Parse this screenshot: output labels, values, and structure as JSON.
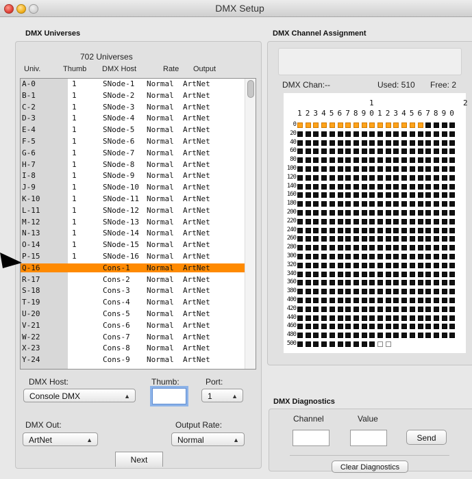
{
  "window": {
    "title": "DMX Setup"
  },
  "universes": {
    "section_title": "DMX Universes",
    "count_label": "702 Universes",
    "columns": [
      "Univ.",
      "Thumb",
      "DMX Host",
      "Rate",
      "Output"
    ],
    "rows": [
      {
        "univ": "A-0",
        "thumb": "1",
        "host": "SNode-1",
        "rate": "Normal",
        "output": "ArtNet"
      },
      {
        "univ": "B-1",
        "thumb": "1",
        "host": "SNode-2",
        "rate": "Normal",
        "output": "ArtNet"
      },
      {
        "univ": "C-2",
        "thumb": "1",
        "host": "SNode-3",
        "rate": "Normal",
        "output": "ArtNet"
      },
      {
        "univ": "D-3",
        "thumb": "1",
        "host": "SNode-4",
        "rate": "Normal",
        "output": "ArtNet"
      },
      {
        "univ": "E-4",
        "thumb": "1",
        "host": "SNode-5",
        "rate": "Normal",
        "output": "ArtNet"
      },
      {
        "univ": "F-5",
        "thumb": "1",
        "host": "SNode-6",
        "rate": "Normal",
        "output": "ArtNet"
      },
      {
        "univ": "G-6",
        "thumb": "1",
        "host": "SNode-7",
        "rate": "Normal",
        "output": "ArtNet"
      },
      {
        "univ": "H-7",
        "thumb": "1",
        "host": "SNode-8",
        "rate": "Normal",
        "output": "ArtNet"
      },
      {
        "univ": "I-8",
        "thumb": "1",
        "host": "SNode-9",
        "rate": "Normal",
        "output": "ArtNet"
      },
      {
        "univ": "J-9",
        "thumb": "1",
        "host": "SNode-10",
        "rate": "Normal",
        "output": "ArtNet"
      },
      {
        "univ": "K-10",
        "thumb": "1",
        "host": "SNode-11",
        "rate": "Normal",
        "output": "ArtNet"
      },
      {
        "univ": "L-11",
        "thumb": "1",
        "host": "SNode-12",
        "rate": "Normal",
        "output": "ArtNet"
      },
      {
        "univ": "M-12",
        "thumb": "1",
        "host": "SNode-13",
        "rate": "Normal",
        "output": "ArtNet"
      },
      {
        "univ": "N-13",
        "thumb": "1",
        "host": "SNode-14",
        "rate": "Normal",
        "output": "ArtNet"
      },
      {
        "univ": "O-14",
        "thumb": "1",
        "host": "SNode-15",
        "rate": "Normal",
        "output": "ArtNet"
      },
      {
        "univ": "P-15",
        "thumb": "1",
        "host": "SNode-16",
        "rate": "Normal",
        "output": "ArtNet"
      },
      {
        "univ": "Q-16",
        "thumb": "",
        "host": "Cons-1",
        "rate": "Normal",
        "output": "ArtNet",
        "selected": true
      },
      {
        "univ": "R-17",
        "thumb": "",
        "host": "Cons-2",
        "rate": "Normal",
        "output": "ArtNet"
      },
      {
        "univ": "S-18",
        "thumb": "",
        "host": "Cons-3",
        "rate": "Normal",
        "output": "ArtNet"
      },
      {
        "univ": "T-19",
        "thumb": "",
        "host": "Cons-4",
        "rate": "Normal",
        "output": "ArtNet"
      },
      {
        "univ": "U-20",
        "thumb": "",
        "host": "Cons-5",
        "rate": "Normal",
        "output": "ArtNet"
      },
      {
        "univ": "V-21",
        "thumb": "",
        "host": "Cons-6",
        "rate": "Normal",
        "output": "ArtNet"
      },
      {
        "univ": "W-22",
        "thumb": "",
        "host": "Cons-7",
        "rate": "Normal",
        "output": "ArtNet"
      },
      {
        "univ": "X-23",
        "thumb": "",
        "host": "Cons-8",
        "rate": "Normal",
        "output": "ArtNet"
      },
      {
        "univ": "Y-24",
        "thumb": "",
        "host": "Cons-9",
        "rate": "Normal",
        "output": "ArtNet"
      }
    ],
    "selected_color": "#ff8a00"
  },
  "controls": {
    "dmx_host_label": "DMX Host:",
    "dmx_host_value": "Console DMX",
    "thumb_label": "Thumb:",
    "thumb_value": "",
    "port_label": "Port:",
    "port_value": "1",
    "dmx_out_label": "DMX Out:",
    "dmx_out_value": "ArtNet",
    "output_rate_label": "Output Rate:",
    "output_rate_value": "Normal",
    "next_label": "Next"
  },
  "assignment": {
    "section_title": "DMX Channel Assignment",
    "chan_label": "DMX Chan:--",
    "used_label": "Used: 510",
    "free_label": "Free: 2",
    "tens_labels": [
      "1",
      "2"
    ],
    "column_digits": [
      "1",
      "2",
      "3",
      "4",
      "5",
      "6",
      "7",
      "8",
      "9",
      "0",
      "1",
      "2",
      "3",
      "4",
      "5",
      "6",
      "7",
      "8",
      "9",
      "0"
    ],
    "row_labels": [
      "0",
      "20",
      "40",
      "60",
      "80",
      "100",
      "120",
      "140",
      "160",
      "180",
      "200",
      "220",
      "240",
      "260",
      "280",
      "300",
      "320",
      "340",
      "360",
      "380",
      "400",
      "420",
      "440",
      "460",
      "480",
      "500"
    ],
    "total_channels": 512,
    "used_channels": 510,
    "highlight_first_row_channels": 16,
    "used_color": "#ffa31a"
  },
  "diagnostics": {
    "section_title": "DMX Diagnostics",
    "channel_label": "Channel",
    "value_label": "Value",
    "send_label": "Send",
    "clear_label": "Clear Diagnostics"
  }
}
